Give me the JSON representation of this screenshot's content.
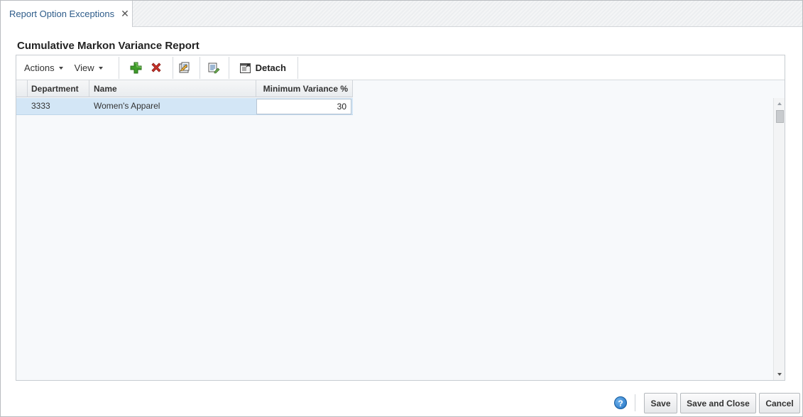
{
  "tab": {
    "label": "Report Option Exceptions",
    "close_glyph": "✕"
  },
  "page_title": "Cumulative Markon Variance Report",
  "toolbar": {
    "actions_label": "Actions",
    "view_label": "View",
    "detach_label": "Detach",
    "icons": [
      "add-icon",
      "delete-icon",
      "edit-icon",
      "mass-update-icon",
      "detach-icon"
    ]
  },
  "table": {
    "columns": [
      "Department",
      "Name",
      "Minimum Variance %"
    ],
    "rows": [
      {
        "department": "3333",
        "name": "Women's Apparel",
        "minimum_variance": "30"
      }
    ]
  },
  "footer": {
    "help_glyph": "?",
    "save_label": "Save",
    "save_close_label": "Save and Close",
    "cancel_label": "Cancel"
  },
  "colors": {
    "tab_text": "#2e5c8a",
    "selected_row": "#d3e6f6",
    "help_icon": "#1f6fbf"
  }
}
